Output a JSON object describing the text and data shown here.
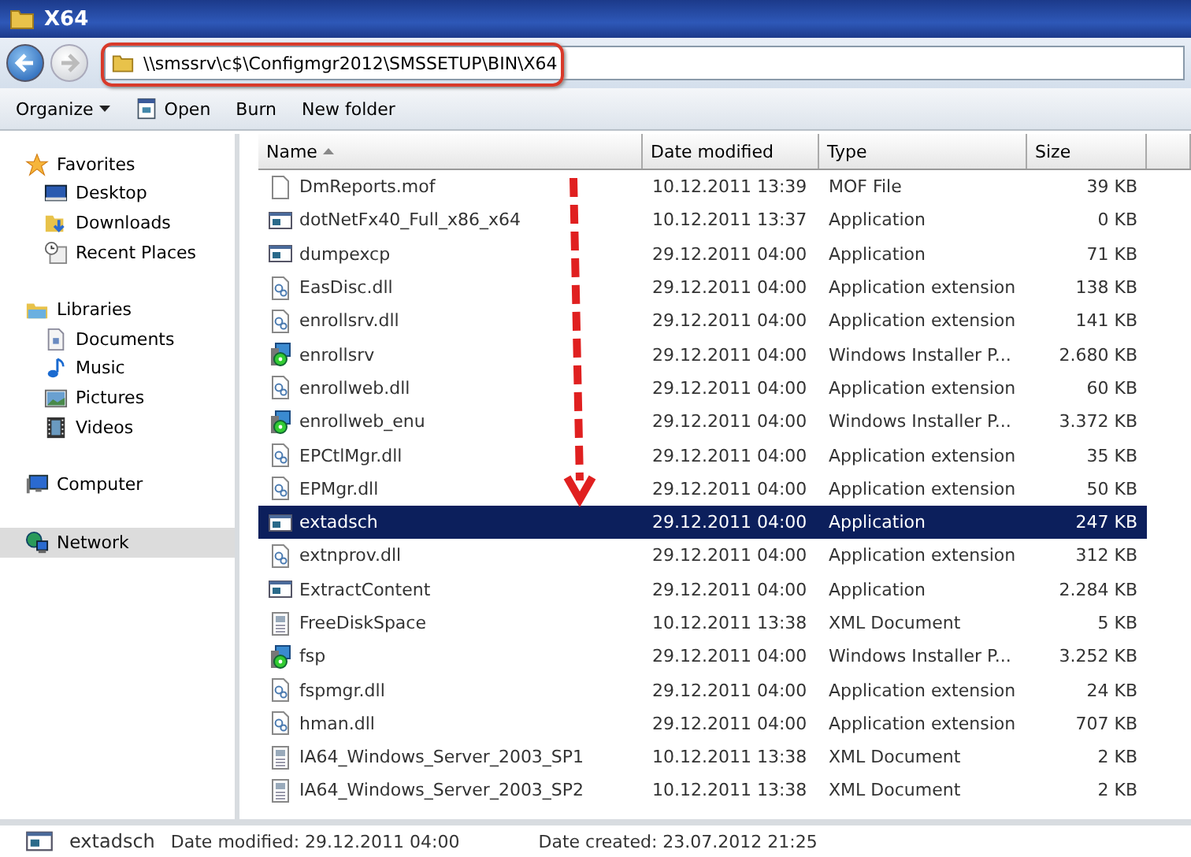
{
  "window": {
    "title": "X64"
  },
  "navigation": {
    "back": {
      "disabled": false
    },
    "forward": {
      "disabled": true
    }
  },
  "address_bar": {
    "path": "\\\\smssrv\\c$\\Configmgr2012\\SMSSETUP\\BIN\\X64",
    "highlighted": true
  },
  "toolbar": [
    {
      "label": "Organize",
      "kind": "menu"
    },
    {
      "label": "Open",
      "kind": "open"
    },
    {
      "label": "Burn",
      "kind": "plain"
    },
    {
      "label": "New folder",
      "kind": "plain"
    }
  ],
  "sidebar": {
    "groups": [
      {
        "label": "Favorites",
        "kind": "star",
        "selected": false,
        "children": [
          {
            "label": "Desktop",
            "kind": "desktop",
            "selected": false
          },
          {
            "label": "Downloads",
            "kind": "downloads",
            "selected": false
          },
          {
            "label": "Recent Places",
            "kind": "recent",
            "selected": false
          }
        ]
      },
      {
        "label": "Libraries",
        "kind": "library",
        "selected": false,
        "children": [
          {
            "label": "Documents",
            "kind": "documents",
            "selected": false
          },
          {
            "label": "Music",
            "kind": "music",
            "selected": false
          },
          {
            "label": "Pictures",
            "kind": "pictures",
            "selected": false
          },
          {
            "label": "Videos",
            "kind": "videos",
            "selected": false
          }
        ]
      },
      {
        "label": "Computer",
        "kind": "computer",
        "selected": false
      },
      {
        "label": "Network",
        "kind": "network",
        "selected": true
      }
    ]
  },
  "table": {
    "columns": [
      {
        "label": "Name",
        "sorted": true
      },
      {
        "label": "Date modified",
        "sorted": false
      },
      {
        "label": "Type",
        "sorted": false
      },
      {
        "label": "Size",
        "sorted": false
      }
    ],
    "rows": [
      {
        "name": "DmReports.mof",
        "date": "10.12.2011 13:39",
        "type": "MOF File",
        "size": "39 KB",
        "kind": "file",
        "selected": false
      },
      {
        "name": "dotNetFx40_Full_x86_x64",
        "date": "10.12.2011 13:37",
        "type": "Application",
        "size": "0 KB",
        "kind": "app",
        "selected": false
      },
      {
        "name": "dumpexcp",
        "date": "29.12.2011 04:00",
        "type": "Application",
        "size": "71 KB",
        "kind": "app",
        "selected": false
      },
      {
        "name": "EasDisc.dll",
        "date": "29.12.2011 04:00",
        "type": "Application extension",
        "size": "138 KB",
        "kind": "dll",
        "selected": false
      },
      {
        "name": "enrollsrv.dll",
        "date": "29.12.2011 04:00",
        "type": "Application extension",
        "size": "141 KB",
        "kind": "dll",
        "selected": false
      },
      {
        "name": "enrollsrv",
        "date": "29.12.2011 04:00",
        "type": "Windows Installer P...",
        "size": "2.680 KB",
        "kind": "msi",
        "selected": false
      },
      {
        "name": "enrollweb.dll",
        "date": "29.12.2011 04:00",
        "type": "Application extension",
        "size": "60 KB",
        "kind": "dll",
        "selected": false
      },
      {
        "name": "enrollweb_enu",
        "date": "29.12.2011 04:00",
        "type": "Windows Installer P...",
        "size": "3.372 KB",
        "kind": "msi",
        "selected": false
      },
      {
        "name": "EPCtlMgr.dll",
        "date": "29.12.2011 04:00",
        "type": "Application extension",
        "size": "35 KB",
        "kind": "dll",
        "selected": false
      },
      {
        "name": "EPMgr.dll",
        "date": "29.12.2011 04:00",
        "type": "Application extension",
        "size": "50 KB",
        "kind": "dll",
        "selected": false
      },
      {
        "name": "extadsch",
        "date": "29.12.2011 04:00",
        "type": "Application",
        "size": "247 KB",
        "kind": "app",
        "selected": true
      },
      {
        "name": "extnprov.dll",
        "date": "29.12.2011 04:00",
        "type": "Application extension",
        "size": "312 KB",
        "kind": "dll",
        "selected": false
      },
      {
        "name": "ExtractContent",
        "date": "29.12.2011 04:00",
        "type": "Application",
        "size": "2.284 KB",
        "kind": "app",
        "selected": false
      },
      {
        "name": "FreeDiskSpace",
        "date": "10.12.2011 13:38",
        "type": "XML Document",
        "size": "5 KB",
        "kind": "xml",
        "selected": false
      },
      {
        "name": "fsp",
        "date": "29.12.2011 04:00",
        "type": "Windows Installer P...",
        "size": "3.252 KB",
        "kind": "msi",
        "selected": false
      },
      {
        "name": "fspmgr.dll",
        "date": "29.12.2011 04:00",
        "type": "Application extension",
        "size": "24 KB",
        "kind": "dll",
        "selected": false
      },
      {
        "name": "hman.dll",
        "date": "29.12.2011 04:00",
        "type": "Application extension",
        "size": "707 KB",
        "kind": "dll",
        "selected": false
      },
      {
        "name": "IA64_Windows_Server_2003_SP1",
        "date": "10.12.2011 13:38",
        "type": "XML Document",
        "size": "2 KB",
        "kind": "xml",
        "selected": false
      },
      {
        "name": "IA64_Windows_Server_2003_SP2",
        "date": "10.12.2011 13:38",
        "type": "XML Document",
        "size": "2 KB",
        "kind": "xml",
        "selected": false
      }
    ]
  },
  "status_bar": {
    "name": "extadsch",
    "modified": "Date modified: 29.12.2011 04:00",
    "created": "Date created: 23.07.2012 21:25"
  }
}
